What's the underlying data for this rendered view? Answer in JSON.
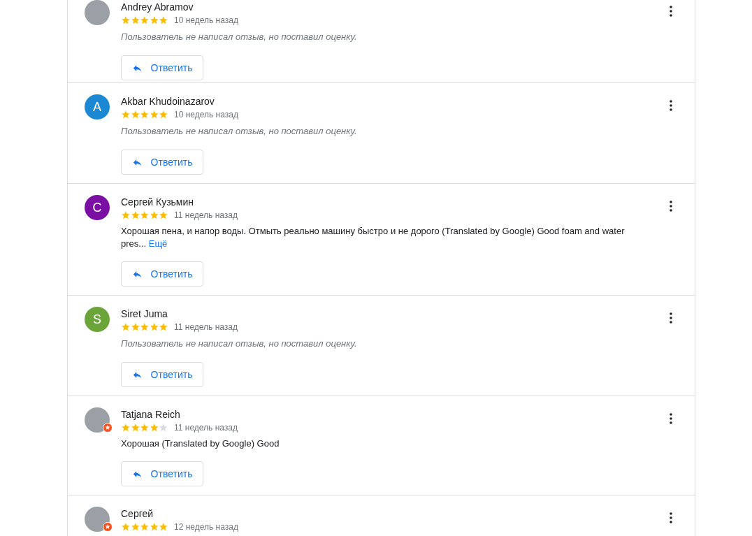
{
  "reviews": [
    {
      "name": "Andrey Abramov",
      "avatar": {
        "kind": "photo",
        "local_guide": false
      },
      "stars": 5,
      "time": "10 недель назад",
      "body": {
        "kind": "note",
        "text": "Пользователь не написал отзыв, но поставил оценку."
      },
      "reply_label": "Ответить"
    },
    {
      "name": "Akbar Khudoinazarov",
      "avatar": {
        "kind": "letter",
        "letter": "A",
        "color": "#1a88d3",
        "local_guide": false
      },
      "stars": 5,
      "time": "10 недель назад",
      "body": {
        "kind": "note",
        "text": "Пользователь не написал отзыв, но поставил оценку."
      },
      "reply_label": "Ответить"
    },
    {
      "name": "Сергей Кузьмин",
      "avatar": {
        "kind": "letter",
        "letter": "С",
        "color": "#7b0fa3",
        "local_guide": false
      },
      "stars": 5,
      "time": "11 недель назад",
      "body": {
        "kind": "text",
        "text": "Хорошая пена, и напор воды. Отмыть реально машину быстро и не дорого (Translated by Google) Good foam and water pres...",
        "more": "Ещё"
      },
      "reply_label": "Ответить"
    },
    {
      "name": "Siret Juma",
      "avatar": {
        "kind": "letter",
        "letter": "S",
        "color": "#6ba539",
        "local_guide": false
      },
      "stars": 5,
      "time": "11 недель назад",
      "body": {
        "kind": "note",
        "text": "Пользователь не написал отзыв, но поставил оценку."
      },
      "reply_label": "Ответить"
    },
    {
      "name": "Tatjana Reich",
      "avatar": {
        "kind": "photo",
        "local_guide": true
      },
      "stars": 4,
      "time": "11 недель назад",
      "body": {
        "kind": "text",
        "text": "Хорошая (Translated by Google) Good"
      },
      "reply_label": "Ответить"
    },
    {
      "name": "Сергей",
      "avatar": {
        "kind": "photo",
        "local_guide": true
      },
      "stars": 5,
      "time": "12 недель назад"
    }
  ]
}
